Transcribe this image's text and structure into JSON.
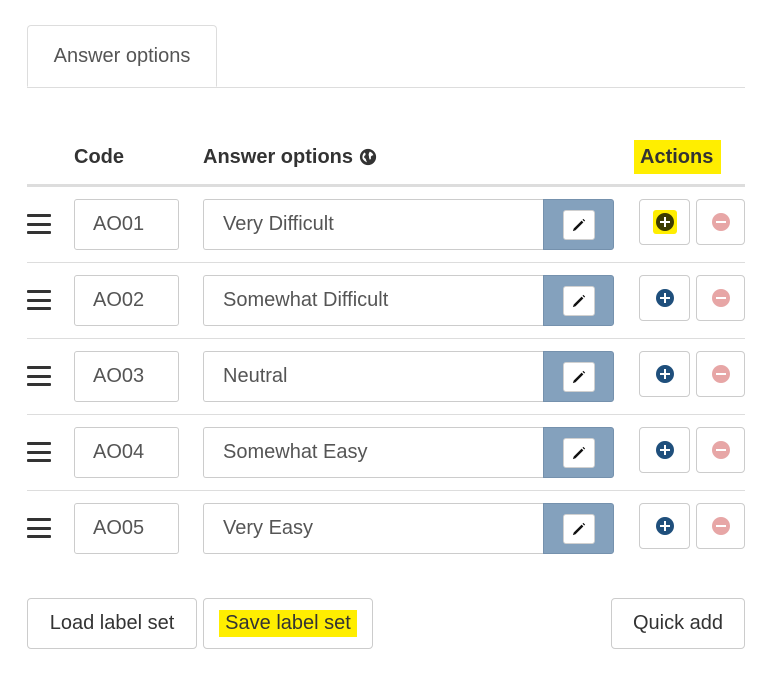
{
  "tabs": [
    {
      "label": "Answer options"
    }
  ],
  "table": {
    "headers": {
      "code": "Code",
      "answer": "Answer options",
      "actions": "Actions"
    },
    "rows": [
      {
        "code": "AO01",
        "answer": "Very Difficult"
      },
      {
        "code": "AO02",
        "answer": "Somewhat Difficult"
      },
      {
        "code": "AO03",
        "answer": "Neutral"
      },
      {
        "code": "AO04",
        "answer": "Somewhat Easy"
      },
      {
        "code": "AO05",
        "answer": "Very Easy"
      }
    ]
  },
  "buttons": {
    "load": "Load label set",
    "save": "Save label set",
    "quick": "Quick add"
  },
  "icons": {
    "drag": "drag-handle-icon",
    "edit": "pencil-icon",
    "add": "plus-circle-icon",
    "remove": "minus-circle-icon",
    "language": "globe-icon"
  },
  "colors": {
    "highlight": "#ffee00",
    "addon": "#84a1bd",
    "add_icon": "#1f4f7c",
    "remove_icon": "#e7a6a6"
  }
}
